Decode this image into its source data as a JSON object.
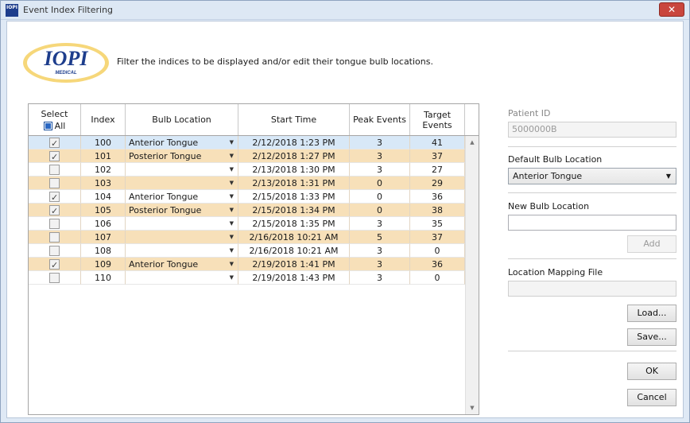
{
  "window": {
    "title": "Event Index Filtering",
    "close_glyph": "✕"
  },
  "logo": {
    "brand": "IOPI",
    "sub": "MEDICAL",
    "icon_text": "IOPI"
  },
  "instructions": "Filter the indices to be displayed and/or edit their tongue bulb locations.",
  "grid": {
    "headers": {
      "select": "Select",
      "all": "All",
      "index": "Index",
      "bulb": "Bulb Location",
      "start": "Start Time",
      "peak": "Peak Events",
      "target": "Target Events"
    },
    "rows": [
      {
        "checked": true,
        "index": "100",
        "bulb": "Anterior Tongue",
        "start": "2/12/2018 1:23 PM",
        "peak": "3",
        "target": "41"
      },
      {
        "checked": true,
        "index": "101",
        "bulb": "Posterior Tongue",
        "start": "2/12/2018 1:27 PM",
        "peak": "3",
        "target": "37"
      },
      {
        "checked": false,
        "index": "102",
        "bulb": "",
        "start": "2/13/2018 1:30 PM",
        "peak": "3",
        "target": "27"
      },
      {
        "checked": false,
        "index": "103",
        "bulb": "",
        "start": "2/13/2018 1:31 PM",
        "peak": "0",
        "target": "29"
      },
      {
        "checked": true,
        "index": "104",
        "bulb": "Anterior Tongue",
        "start": "2/15/2018 1:33 PM",
        "peak": "0",
        "target": "36"
      },
      {
        "checked": true,
        "index": "105",
        "bulb": "Posterior Tongue",
        "start": "2/15/2018 1:34 PM",
        "peak": "0",
        "target": "38"
      },
      {
        "checked": false,
        "index": "106",
        "bulb": "",
        "start": "2/15/2018 1:35 PM",
        "peak": "3",
        "target": "35"
      },
      {
        "checked": false,
        "index": "107",
        "bulb": "",
        "start": "2/16/2018 10:21 AM",
        "peak": "5",
        "target": "37"
      },
      {
        "checked": false,
        "index": "108",
        "bulb": "",
        "start": "2/16/2018 10:21 AM",
        "peak": "3",
        "target": "0"
      },
      {
        "checked": true,
        "index": "109",
        "bulb": "Anterior Tongue",
        "start": "2/19/2018 1:41 PM",
        "peak": "3",
        "target": "36"
      },
      {
        "checked": false,
        "index": "110",
        "bulb": "",
        "start": "2/19/2018 1:43 PM",
        "peak": "3",
        "target": "0"
      }
    ]
  },
  "side": {
    "patient_id_label": "Patient ID",
    "patient_id_value": "5000000B",
    "default_bulb_label": "Default Bulb Location",
    "default_bulb_value": "Anterior Tongue",
    "new_bulb_label": "New Bulb Location",
    "new_bulb_value": "",
    "add_label": "Add",
    "mapping_label": "Location Mapping File",
    "mapping_value": "",
    "load_label": "Load...",
    "save_label": "Save...",
    "ok_label": "OK",
    "cancel_label": "Cancel"
  },
  "colors": {
    "row_alt": "#f7e0b9",
    "row_selected": "#d8e8f7",
    "logo_blue": "#1d3d8c",
    "logo_gold": "#f0c24a",
    "close_red": "#c9463d"
  }
}
